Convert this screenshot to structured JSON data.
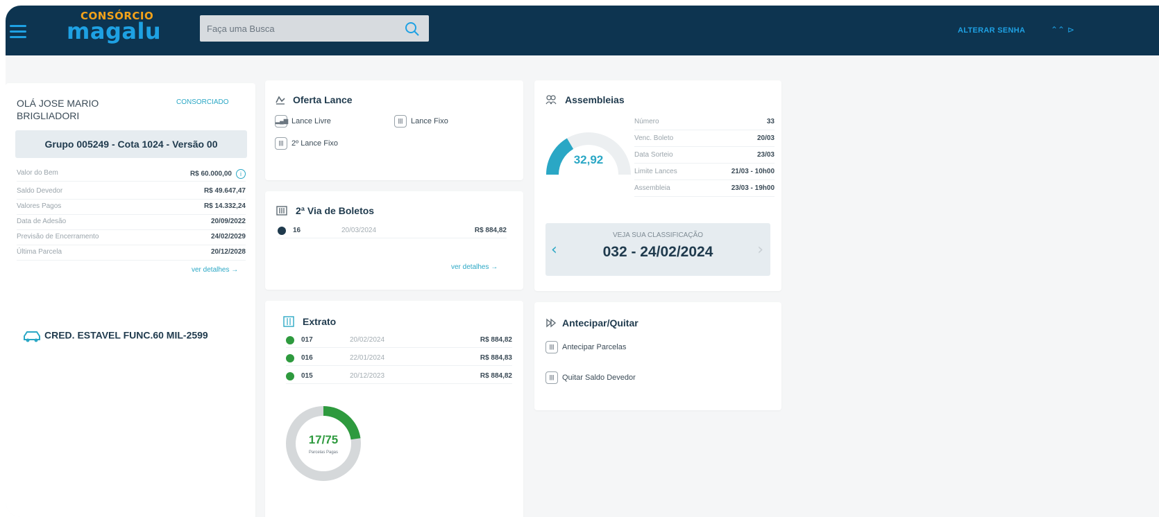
{
  "header": {
    "logo_top": "CONSÓRCIO",
    "logo_main": "magalu",
    "search_placeholder": "Faça uma Busca",
    "user_link": "ALTERAR SENHA",
    "extra_icons": "⌃⌃ ⊳"
  },
  "profile": {
    "greeting": "OLÁ JOSE MARIO BRIGLIADORI",
    "role": "CONSORCIADO",
    "group": "Grupo 005249 - Cota 1024 - Versão 00",
    "rows": [
      {
        "label": "Valor do Bem",
        "value": "R$ 60.000,00"
      },
      {
        "label": "Saldo Devedor",
        "value": "R$ 49.647,47"
      },
      {
        "label": "Valores Pagos",
        "value": "R$ 14.332,24"
      },
      {
        "label": "Data de Adesão",
        "value": "20/09/2022"
      },
      {
        "label": "Previsão de Encerramento",
        "value": "24/02/2029"
      },
      {
        "label": "Última Parcela",
        "value": "20/12/2028"
      }
    ],
    "details_link": "ver detalhes →",
    "credit_name": "CRED. ESTAVEL FUNC.60 MIL-2599"
  },
  "oferta": {
    "title": "Oferta Lance",
    "options": [
      {
        "label": "Lance Livre",
        "icon": "bar-chart-icon"
      },
      {
        "label": "Lance Fixo",
        "icon": "barcode-icon"
      },
      {
        "label": "2º Lance Fixo",
        "icon": "barcode-icon"
      }
    ]
  },
  "boletos": {
    "title": "2ª Via de Boletos",
    "rows": [
      {
        "num": "16",
        "date": "20/03/2024",
        "amount": "R$ 884,82"
      }
    ],
    "details_link": "ver detalhes →"
  },
  "extrato": {
    "title": "Extrato",
    "rows": [
      {
        "num": "017",
        "date": "20/02/2024",
        "amount": "R$ 884,82"
      },
      {
        "num": "016",
        "date": "22/01/2024",
        "amount": "R$ 884,83"
      },
      {
        "num": "015",
        "date": "20/12/2023",
        "amount": "R$ 884,82"
      }
    ],
    "donut_value": "17/75",
    "donut_label": "Parcelas Pagas",
    "donut_fraction": 0.227
  },
  "assembleias": {
    "title": "Assembleias",
    "gauge_value": "32,92",
    "gauge_fraction": 0.33,
    "rows": [
      {
        "label": "Número",
        "value": "33"
      },
      {
        "label": "Venc. Boleto",
        "value": "20/03"
      },
      {
        "label": "Data Sorteio",
        "value": "23/03"
      },
      {
        "label": "Limite Lances",
        "value": "21/03 - 10h00"
      },
      {
        "label": "Assembleia",
        "value": "23/03 - 19h00"
      }
    ],
    "classification_label": "VEJA SUA CLASSIFICAÇÃO",
    "classification_value": "032 - 24/02/2024"
  },
  "antecipar": {
    "title": "Antecipar/Quitar",
    "options": [
      {
        "label": "Antecipar Parcelas"
      },
      {
        "label": "Quitar Saldo Devedor"
      }
    ]
  },
  "colors": {
    "navy": "#0d3450",
    "accent_blue": "#1ea1e3",
    "teal": "#2aa7c5",
    "green": "#2e9a3e",
    "orange": "#f3a21a"
  }
}
